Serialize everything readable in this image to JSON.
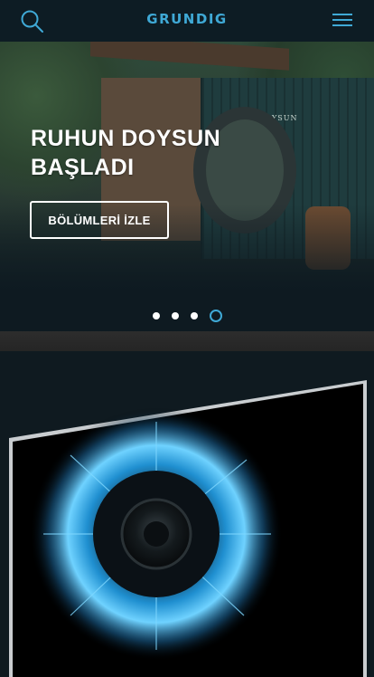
{
  "header": {
    "logo_text": "GRUNDIG",
    "search_icon": "search-icon",
    "menu_icon": "hamburger-menu-icon"
  },
  "hero": {
    "headline_line1": "RUHUN DOYSUN",
    "headline_line2": "BAŞLADI",
    "cta_label": "BÖLÜMLERİ İZLE",
    "container_label": "RUHUN DOYSUN",
    "slides_total": 4,
    "active_slide": 4
  },
  "colors": {
    "accent": "#3fa9d6",
    "header_bg": "#0d1c24",
    "page_bg": "#0f1a20"
  }
}
